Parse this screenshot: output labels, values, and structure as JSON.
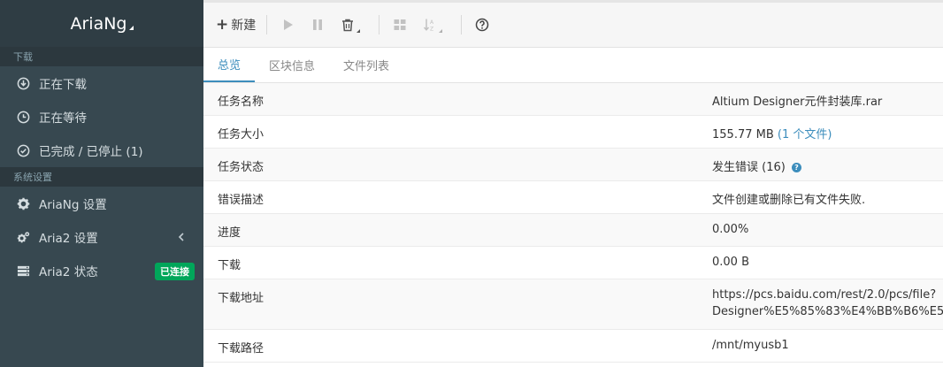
{
  "brand": {
    "title": "AriaNg"
  },
  "sidebar": {
    "section_download": "下载",
    "items_download": [
      {
        "label": "正在下载",
        "icon": "download-circle-icon"
      },
      {
        "label": "正在等待",
        "icon": "clock-icon"
      },
      {
        "label": "已完成 / 已停止 (1)",
        "icon": "check-circle-icon"
      }
    ],
    "section_settings": "系统设置",
    "items_settings": [
      {
        "label": "AriaNg 设置",
        "icon": "gear-icon"
      },
      {
        "label": "Aria2 设置",
        "icon": "gears-icon"
      },
      {
        "label": "Aria2 状态",
        "icon": "server-icon",
        "badge": "已连接"
      }
    ]
  },
  "toolbar": {
    "new_label": "新建"
  },
  "tabs": [
    "总览",
    "区块信息",
    "文件列表"
  ],
  "details": {
    "rows": [
      {
        "label": "任务名称",
        "value": "Altium Designer元件封装库.rar"
      },
      {
        "label": "任务大小",
        "value": "155.77 MB",
        "link": "(1 个文件)"
      },
      {
        "label": "任务状态",
        "value": "发生错误 (16)"
      },
      {
        "label": "错误描述",
        "value": "文件创建或删除已有文件失败."
      },
      {
        "label": "进度",
        "value": "0.00%"
      },
      {
        "label": "下载",
        "value": "0.00 B"
      },
      {
        "label": "下载地址",
        "value_line1": "https://pcs.baidu.com/rest/2.0/pcs/file?",
        "value_line2": "Designer%E5%85%83%E4%BB%B6%E5"
      },
      {
        "label": "下载路径",
        "value": "/mnt/myusb1"
      }
    ]
  },
  "colors": {
    "sidebar_bg": "#374850",
    "accent": "#3c8dbc",
    "badge_green": "#00a65a"
  }
}
